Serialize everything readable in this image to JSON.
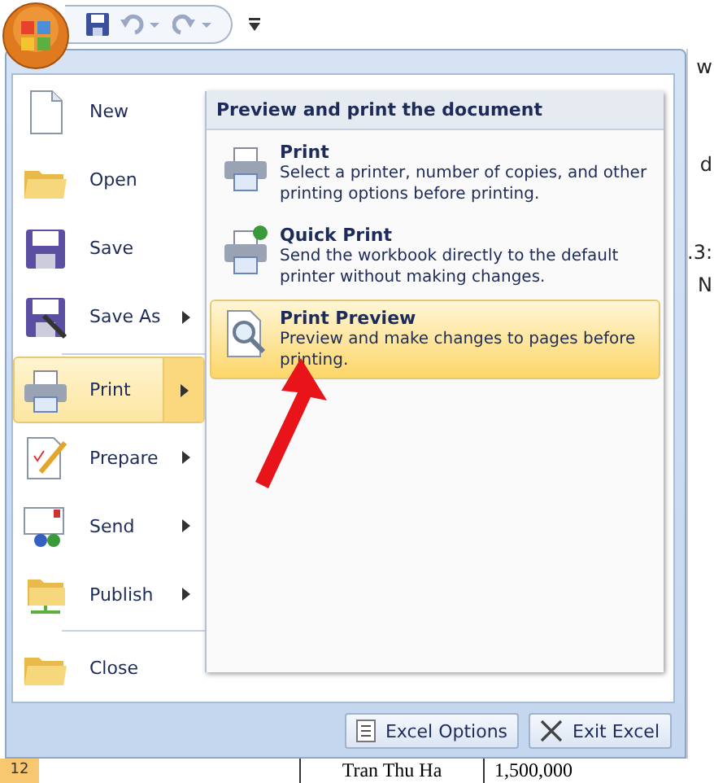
{
  "menu": {
    "items": [
      {
        "label": "New",
        "has_submenu": false,
        "selected": false
      },
      {
        "label": "Open",
        "has_submenu": false,
        "selected": false
      },
      {
        "label": "Save",
        "has_submenu": false,
        "selected": false
      },
      {
        "label": "Save As",
        "has_submenu": true,
        "selected": false
      },
      {
        "label": "Print",
        "has_submenu": true,
        "selected": true
      },
      {
        "label": "Prepare",
        "has_submenu": true,
        "selected": false
      },
      {
        "label": "Send",
        "has_submenu": true,
        "selected": false
      },
      {
        "label": "Publish",
        "has_submenu": true,
        "selected": false
      },
      {
        "label": "Close",
        "has_submenu": false,
        "selected": false
      }
    ],
    "submenu": {
      "title": "Preview and print the document",
      "items": [
        {
          "title": "Print",
          "description": "Select a printer, number of copies, and other printing options before printing.",
          "selected": false
        },
        {
          "title": "Quick Print",
          "description": "Send the workbook directly to the default printer without making changes.",
          "selected": false
        },
        {
          "title": "Print Preview",
          "description": "Preview and make changes to pages before printing.",
          "selected": true
        }
      ]
    },
    "buttons": [
      "Excel Options",
      "Exit Excel"
    ]
  },
  "sheet": {
    "column_fragments": [
      "w",
      "d",
      ".3:",
      "N"
    ],
    "row": {
      "header": "12",
      "cells": [
        "Tran Thu Ha",
        "1,500,000"
      ]
    }
  }
}
